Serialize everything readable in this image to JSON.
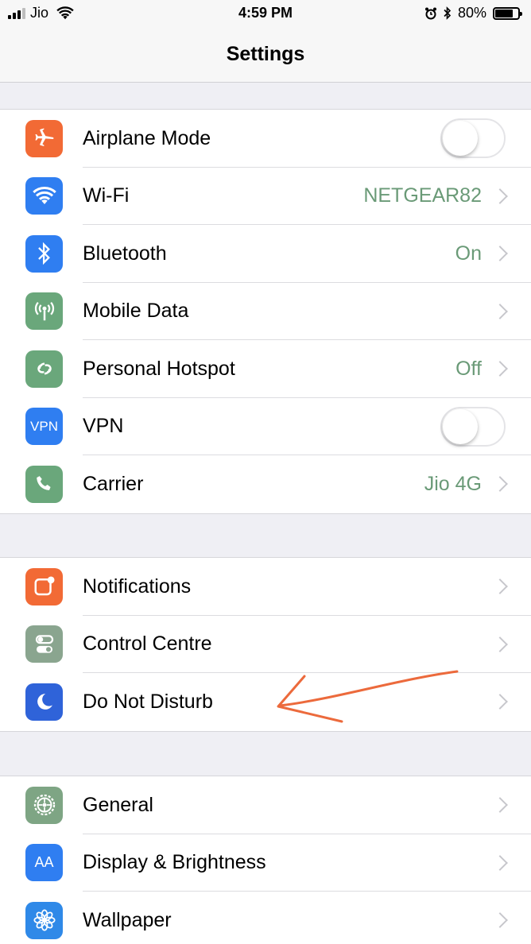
{
  "status": {
    "carrier": "Jio",
    "time": "4:59 PM",
    "battery": "80%",
    "battery_level": 0.8
  },
  "nav": {
    "title": "Settings"
  },
  "groups": [
    {
      "rows": [
        {
          "label": "Airplane Mode",
          "icon": "airplane-icon",
          "color": "#f26a35",
          "control": "toggle",
          "on": false
        },
        {
          "label": "Wi-Fi",
          "icon": "wifi-icon",
          "color": "#2f7ef1",
          "value": "NETGEAR82"
        },
        {
          "label": "Bluetooth",
          "icon": "bluetooth-icon",
          "color": "#2f7ef1",
          "value": "On"
        },
        {
          "label": "Mobile Data",
          "icon": "antenna-icon",
          "color": "#6aa77b"
        },
        {
          "label": "Personal Hotspot",
          "icon": "hotspot-icon",
          "color": "#6aa77b",
          "value": "Off"
        },
        {
          "label": "VPN",
          "icon": "vpn-icon",
          "icon_text": "VPN",
          "color": "#2f7ef1",
          "control": "toggle",
          "on": false
        },
        {
          "label": "Carrier",
          "icon": "phone-icon",
          "color": "#6aa77b",
          "value": "Jio 4G"
        }
      ]
    },
    {
      "rows": [
        {
          "label": "Notifications",
          "icon": "notifications-icon",
          "color": "#f26a35"
        },
        {
          "label": "Control Centre",
          "icon": "control-centre-icon",
          "color": "#8aa58f"
        },
        {
          "label": "Do Not Disturb",
          "icon": "moon-icon",
          "color": "#2f63d9"
        }
      ]
    },
    {
      "rows": [
        {
          "label": "General",
          "icon": "gear-icon",
          "color": "#7ea584"
        },
        {
          "label": "Display & Brightness",
          "icon": "text-size-icon",
          "icon_text": "AA",
          "color": "#2f7ef1"
        },
        {
          "label": "Wallpaper",
          "icon": "flower-icon",
          "color": "#2f89e8"
        }
      ]
    }
  ],
  "annotation": {
    "type": "hand-drawn-arrow",
    "color": "#ec6a3c",
    "points_to": "Do Not Disturb"
  }
}
